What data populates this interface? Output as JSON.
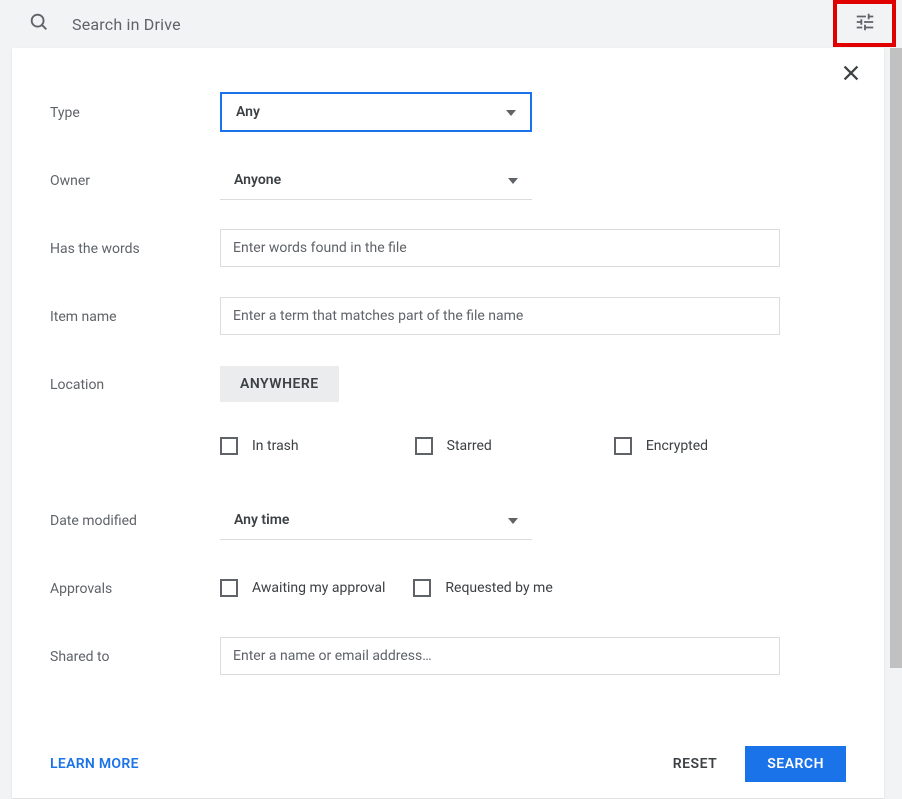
{
  "search": {
    "placeholder": "Search in Drive"
  },
  "form": {
    "type": {
      "label": "Type",
      "value": "Any"
    },
    "owner": {
      "label": "Owner",
      "value": "Anyone"
    },
    "hasWords": {
      "label": "Has the words",
      "placeholder": "Enter words found in the file"
    },
    "itemName": {
      "label": "Item name",
      "placeholder": "Enter a term that matches part of the file name"
    },
    "location": {
      "label": "Location",
      "chip": "ANYWHERE"
    },
    "locationFlags": {
      "inTrash": "In trash",
      "starred": "Starred",
      "encrypted": "Encrypted"
    },
    "dateModified": {
      "label": "Date modified",
      "value": "Any time"
    },
    "approvals": {
      "label": "Approvals",
      "awaiting": "Awaiting my approval",
      "requested": "Requested by me"
    },
    "sharedTo": {
      "label": "Shared to",
      "placeholder": "Enter a name or email address…"
    }
  },
  "footer": {
    "learnMore": "LEARN MORE",
    "reset": "RESET",
    "search": "SEARCH"
  }
}
